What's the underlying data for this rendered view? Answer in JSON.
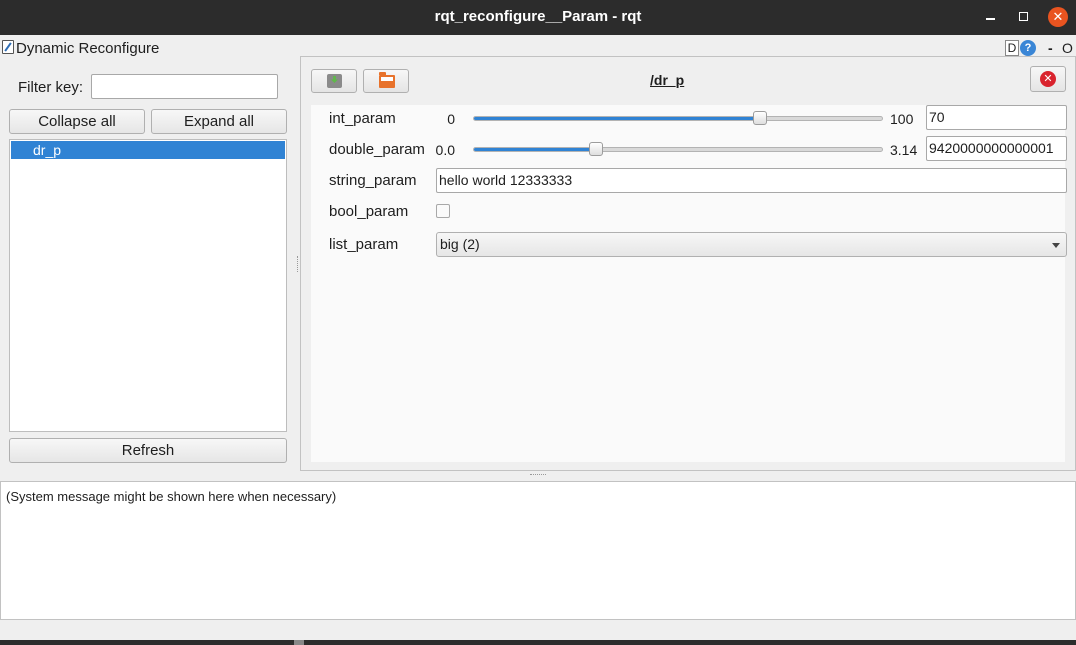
{
  "window": {
    "title": "rqt_reconfigure__Param - rqt",
    "minimize_glyph": "",
    "close_glyph": "✕"
  },
  "dock": {
    "plugin_title": "Dynamic Reconfigure",
    "d_button": "D",
    "help_button": "?",
    "minimize_label": "-",
    "float_label": "O"
  },
  "left_panel": {
    "filter_label": "Filter key:",
    "filter_value": "",
    "collapse_all_label": "Collapse all",
    "expand_all_label": "Expand all",
    "tree_items": [
      "dr_p"
    ],
    "refresh_label": "Refresh"
  },
  "node": {
    "title": "/dr_p",
    "close_glyph": "✕",
    "toolbar": {
      "save_icon": "save-icon",
      "load_icon": "folder-open-icon"
    }
  },
  "params": {
    "int_param": {
      "label": "int_param",
      "min": "0",
      "max": "100",
      "value": "70",
      "fraction": 0.7
    },
    "double_param": {
      "label": "double_param",
      "min": "0.0",
      "max": "3.14",
      "value": "9420000000000001",
      "fraction": 0.3
    },
    "string_param": {
      "label": "string_param",
      "value": "hello world 12333333"
    },
    "bool_param": {
      "label": "bool_param",
      "checked": false
    },
    "list_param": {
      "label": "list_param",
      "selected": "big (2)"
    }
  },
  "messages": {
    "text": "(System message might be shown here when necessary)"
  },
  "colors": {
    "accent": "#3083d4",
    "titlebar": "#2c2c2c",
    "close_button": "#e95420",
    "node_close": "#d9232d"
  }
}
